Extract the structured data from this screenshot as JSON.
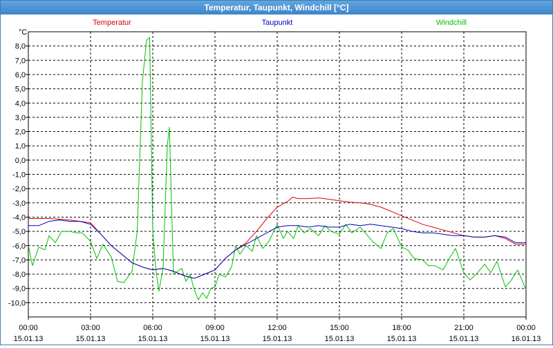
{
  "window": {
    "title": "Temperatur, Taupunkt, Windchill [°C]"
  },
  "chart_data": {
    "type": "line",
    "title": "Temperatur, Taupunkt, Windchill [°C]",
    "ylabel": "°C",
    "ylim": [
      -11,
      9
    ],
    "xlim": [
      0,
      24
    ],
    "grid": true,
    "legend_position": "top",
    "y_ticks": [
      "8,0",
      "7,0",
      "6,0",
      "5,0",
      "4,0",
      "3,0",
      "2,0",
      "1,0",
      "0,0",
      "-1,0",
      "-2,0",
      "-3,0",
      "-4,0",
      "-5,0",
      "-6,0",
      "-7,0",
      "-8,0",
      "-9,0",
      "-10,0"
    ],
    "x_ticks": [
      {
        "time": "00:00",
        "date": "15.01.13"
      },
      {
        "time": "03:00",
        "date": "15.01.13"
      },
      {
        "time": "06:00",
        "date": "15.01.13"
      },
      {
        "time": "09:00",
        "date": "15.01.13"
      },
      {
        "time": "12:00",
        "date": "15.01.13"
      },
      {
        "time": "15:00",
        "date": "15.01.13"
      },
      {
        "time": "18:00",
        "date": "15.01.13"
      },
      {
        "time": "21:00",
        "date": "15.01.13"
      },
      {
        "time": "00:00",
        "date": "16.01.13"
      }
    ],
    "series": [
      {
        "name": "Temperatur",
        "color": "#e00000",
        "x": [
          0,
          0.5,
          1,
          1.5,
          2,
          2.5,
          3,
          3.5,
          4,
          4.5,
          5,
          5.5,
          6,
          6.5,
          7,
          7.5,
          8,
          8.5,
          9,
          9.5,
          10,
          10.5,
          11,
          11.5,
          12,
          12.5,
          12.75,
          13,
          13.5,
          14,
          14.5,
          15,
          15.5,
          16,
          16.5,
          17,
          17.5,
          18,
          18.5,
          19,
          19.5,
          20,
          20.5,
          21,
          21.5,
          22,
          22.5,
          23,
          23.5,
          24
        ],
        "y": [
          -4.1,
          -4.1,
          -4.1,
          -4.15,
          -4.2,
          -4.3,
          -4.4,
          -5.2,
          -6.0,
          -6.6,
          -7.2,
          -7.5,
          -7.7,
          -7.6,
          -7.8,
          -8.1,
          -8.3,
          -8.0,
          -7.7,
          -6.9,
          -6.3,
          -5.8,
          -5.0,
          -4.1,
          -3.3,
          -2.9,
          -2.6,
          -2.7,
          -2.7,
          -2.65,
          -2.75,
          -2.85,
          -2.95,
          -3.0,
          -3.1,
          -3.3,
          -3.6,
          -3.9,
          -4.2,
          -4.5,
          -4.7,
          -4.9,
          -5.1,
          -5.3,
          -5.4,
          -5.4,
          -5.3,
          -5.5,
          -5.9,
          -5.9
        ]
      },
      {
        "name": "Taupunkt",
        "color": "#0000c0",
        "x": [
          0,
          0.5,
          1,
          1.5,
          2,
          2.5,
          3,
          3.5,
          4,
          4.5,
          5,
          5.5,
          6,
          6.5,
          7,
          7.5,
          8,
          8.5,
          9,
          9.5,
          10,
          10.5,
          11,
          11.5,
          12,
          12.5,
          13,
          13.5,
          14,
          14.5,
          15,
          15.5,
          16,
          16.5,
          17,
          17.5,
          18,
          18.5,
          19,
          19.5,
          20,
          20.5,
          21,
          21.5,
          22,
          22.5,
          23,
          23.5,
          24
        ],
        "y": [
          -4.6,
          -4.6,
          -4.3,
          -4.2,
          -4.3,
          -4.3,
          -4.5,
          -5.2,
          -6.0,
          -6.6,
          -7.2,
          -7.5,
          -7.7,
          -7.6,
          -7.8,
          -8.1,
          -8.3,
          -8.0,
          -7.7,
          -6.9,
          -6.3,
          -5.9,
          -5.5,
          -5.1,
          -4.7,
          -4.6,
          -4.6,
          -4.7,
          -4.6,
          -4.7,
          -4.7,
          -4.5,
          -4.6,
          -4.5,
          -4.6,
          -4.7,
          -4.8,
          -5.0,
          -5.1,
          -5.1,
          -5.2,
          -5.3,
          -5.3,
          -5.4,
          -5.4,
          -5.3,
          -5.4,
          -5.8,
          -5.8
        ]
      },
      {
        "name": "Windchill",
        "color": "#00c000",
        "x": [
          0,
          0.2,
          0.5,
          0.8,
          1,
          1.3,
          1.6,
          2,
          2.3,
          2.6,
          3,
          3.3,
          3.6,
          4,
          4.3,
          4.6,
          5,
          5.25,
          5.5,
          5.7,
          5.85,
          6,
          6.15,
          6.3,
          6.5,
          6.7,
          6.8,
          7,
          7.2,
          7.4,
          7.6,
          7.8,
          8,
          8.2,
          8.4,
          8.6,
          8.8,
          9,
          9.2,
          9.5,
          9.8,
          10,
          10.2,
          10.5,
          10.8,
          11,
          11.3,
          11.6,
          12,
          12.3,
          12.5,
          12.8,
          13,
          13.3,
          13.6,
          14,
          14.3,
          14.6,
          15,
          15.3,
          15.6,
          16,
          16.3,
          16.6,
          17,
          17.3,
          17.6,
          18,
          18.3,
          18.6,
          19,
          19.3,
          19.6,
          20,
          20.3,
          20.6,
          21,
          21.3,
          21.6,
          22,
          22.3,
          22.6,
          23,
          23.3,
          23.6,
          24
        ],
        "y": [
          -6.0,
          -7.4,
          -6.1,
          -6.3,
          -5.3,
          -5.8,
          -5.0,
          -5.0,
          -5.1,
          -5.1,
          -5.7,
          -6.9,
          -5.9,
          -6.8,
          -8.5,
          -8.6,
          -7.8,
          -5.0,
          5.5,
          8.4,
          8.6,
          -5.0,
          -7.7,
          -9.2,
          -7.5,
          1.0,
          2.3,
          -8.0,
          -7.8,
          -7.6,
          -8.5,
          -8.0,
          -9.1,
          -9.8,
          -9.3,
          -9.7,
          -9.0,
          -8.9,
          -8.0,
          -8.2,
          -7.5,
          -6.0,
          -6.6,
          -6.0,
          -6.4,
          -5.3,
          -6.2,
          -5.7,
          -4.5,
          -5.5,
          -5.0,
          -5.5,
          -4.6,
          -5.1,
          -4.8,
          -5.3,
          -4.6,
          -5.0,
          -5.2,
          -4.5,
          -5.1,
          -4.7,
          -5.2,
          -5.7,
          -6.2,
          -5.1,
          -4.8,
          -6.1,
          -6.3,
          -6.9,
          -7.0,
          -7.4,
          -7.4,
          -7.7,
          -6.9,
          -6.2,
          -7.9,
          -8.4,
          -8.0,
          -7.3,
          -7.9,
          -7.1,
          -8.9,
          -8.4,
          -7.7,
          -9.1
        ]
      }
    ]
  }
}
